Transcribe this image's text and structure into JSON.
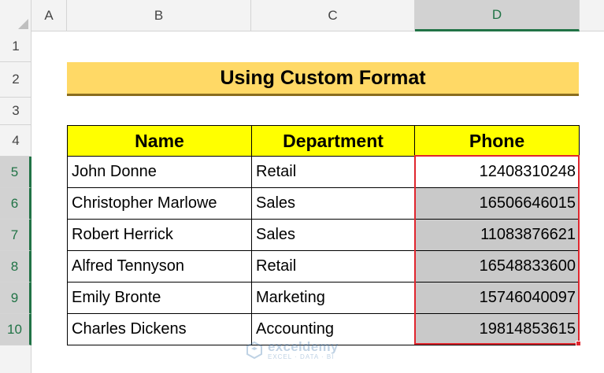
{
  "sheet": {
    "columns": [
      "A",
      "B",
      "C",
      "D"
    ],
    "rows": [
      "1",
      "2",
      "3",
      "4",
      "5",
      "6",
      "7",
      "8",
      "9",
      "10"
    ]
  },
  "title": "Using Custom Format",
  "table": {
    "headers": [
      "Name",
      "Department",
      "Phone"
    ],
    "rows": [
      [
        "John Donne",
        "Retail",
        "12408310248"
      ],
      [
        "Christopher Marlowe",
        "Sales",
        "16506646015"
      ],
      [
        "Robert Herrick",
        "Sales",
        "11083876621"
      ],
      [
        "Alfred Tennyson",
        "Retail",
        "16548833600"
      ],
      [
        "Emily Bronte",
        "Marketing",
        "15746040097"
      ],
      [
        "Charles Dickens",
        "Accounting",
        "19814853615"
      ]
    ]
  },
  "watermark": {
    "name": "exceldemy",
    "tagline": "EXCEL · DATA · BI"
  },
  "colors": {
    "title_fill": "#ffd966",
    "header_fill": "#ffff00",
    "selection_border": "#e0262e",
    "selected_header": "#217346",
    "selected_fill": "#c9c9c9"
  }
}
